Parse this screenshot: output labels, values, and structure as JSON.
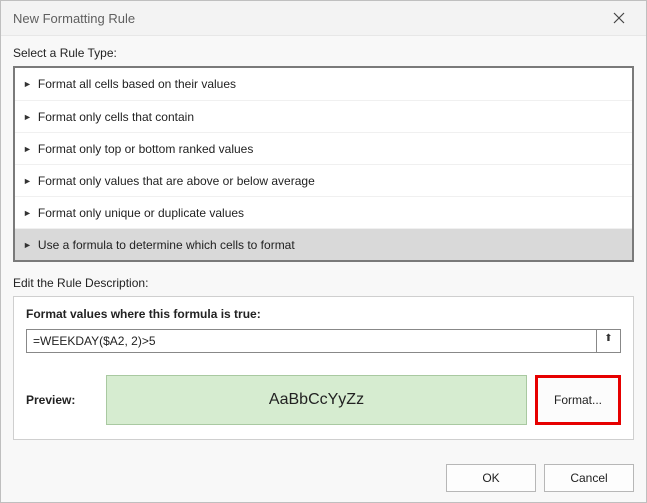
{
  "title": "New Formatting Rule",
  "select_rule_label": "Select a Rule Type:",
  "rule_types": [
    {
      "label": "Format all cells based on their values",
      "selected": false
    },
    {
      "label": "Format only cells that contain",
      "selected": false
    },
    {
      "label": "Format only top or bottom ranked values",
      "selected": false
    },
    {
      "label": "Format only values that are above or below average",
      "selected": false
    },
    {
      "label": "Format only unique or duplicate values",
      "selected": false
    },
    {
      "label": "Use a formula to determine which cells to format",
      "selected": true
    }
  ],
  "edit_desc_label": "Edit the Rule Description:",
  "formula_title": "Format values where this formula is true:",
  "formula_value": "=WEEKDAY($A2, 2)>5",
  "preview_label": "Preview:",
  "preview_sample": "AaBbCcYyZz",
  "preview_bg": "#d6ecd0",
  "format_button": "Format...",
  "ok_label": "OK",
  "cancel_label": "Cancel"
}
